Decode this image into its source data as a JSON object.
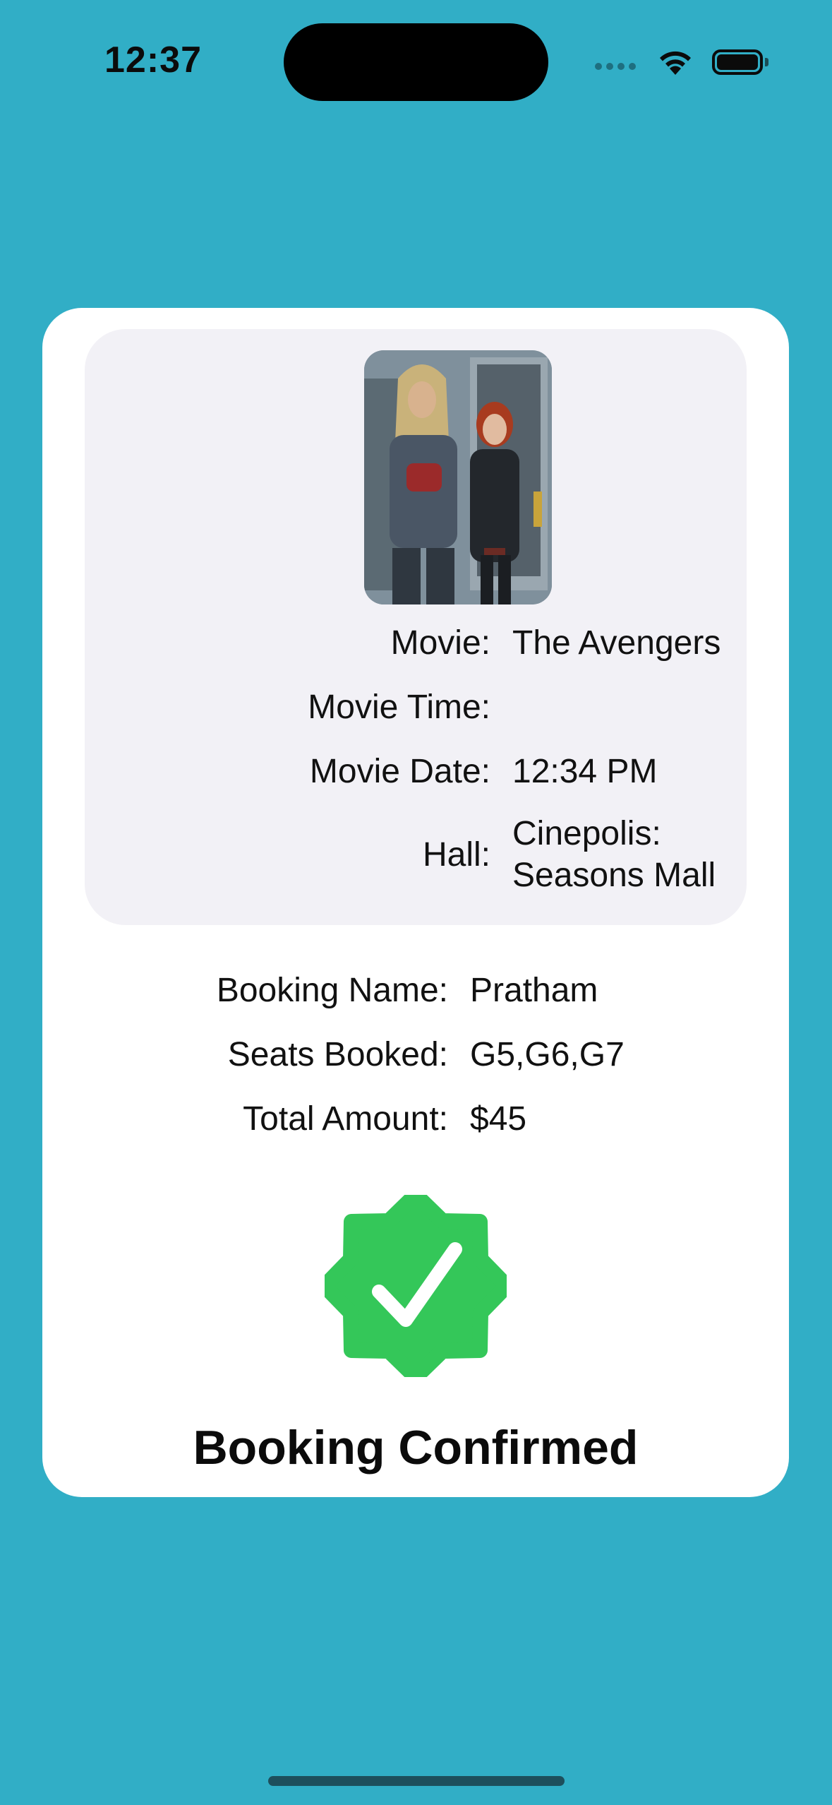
{
  "status_bar": {
    "time": "12:37",
    "icons": [
      "signal-dots-icon",
      "wifi-icon",
      "battery-icon"
    ]
  },
  "movie": {
    "poster_icon": "movie-poster-image",
    "rows": [
      {
        "label": "Movie:",
        "value": "The Avengers"
      },
      {
        "label": "Movie Time:",
        "value": ""
      },
      {
        "label": "Movie Date:",
        "value": "12:34 PM"
      },
      {
        "label": "Hall:",
        "value_line1": "Cinepolis:",
        "value_line2": "Seasons Mall"
      }
    ]
  },
  "booking": {
    "rows": [
      {
        "label": "Booking Name:",
        "value": "Pratham"
      },
      {
        "label": "Seats Booked:",
        "value": "G5,G6,G7"
      },
      {
        "label": "Total Amount:",
        "value": "$45"
      }
    ]
  },
  "confirmation": {
    "badge_icon": "verified-check-badge-icon",
    "title": "Booking Confirmed"
  },
  "colors": {
    "background": "#31AEC6",
    "card": "#FFFFFF",
    "panel": "#F2F1F6",
    "badge_green": "#34C759"
  }
}
